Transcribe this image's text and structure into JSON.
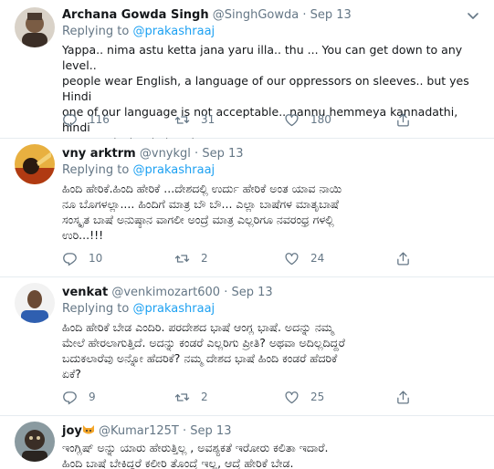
{
  "tweets": [
    {
      "name": "Archana Gowda Singh",
      "handle": "@SinghGowda",
      "date": "Sep 13",
      "replying_prefix": "Replying to",
      "replying_to": "@prakashraaj",
      "text_lines": [
        "Yappa.. nima astu ketta jana yaru illa.. thu ...  You can get down to any level..",
        "people wear English, a language of our oppressors on sleeves.. but yes Hindi",
        "one of our language is not acceptable.. nannu hemmeya kannadathi, hindi",
        "namma desha da basshe..."
      ],
      "replies": "116",
      "retweets": "31",
      "likes": "180",
      "avatar_color": "#6b5a4e"
    },
    {
      "name": "vny arktrm",
      "handle": "@vnykgl",
      "date": "Sep 13",
      "replying_prefix": "Replying to",
      "replying_to": "@prakashraaj",
      "text_lines": [
        "ಹಿಂದಿ ಹೇರಿಕೆ.ಹಿಂದಿ ಹೇರಿಕೆ ...ದೇಶದಲ್ಲಿ ಉರ್ದು ಹೇರಿಕೆ ಅಂತ ಯಾವ ನಾಯಿ",
        "ನೂ ಬೊಗಳಲ್ಲಾ.... ಹಿಂದಿಗೆ ಮಾತ್ರ ಬೌ ಬೌ... ಎಲ್ಲಾ ಬಾಷೆಗಳ ಮಾತೃಬಾಷೆ",
        "ಸಂಸ್ಕೃತ ಬಾಷೆ ಅನುಷ್ಠಾನ ವಾಗಲೀ ಅಂದ್ರೆ ಮಾತ್ರ ಎಲ್ಲರಿಗೂ ನವರಂಧ್ರ ಗಳಲ್ಲಿ",
        "ಉರಿ...!!!"
      ],
      "replies": "10",
      "retweets": "2",
      "likes": "24",
      "avatar_color": "#c8531c"
    },
    {
      "name": "venkat",
      "handle": "@venkimozart600",
      "date": "Sep 13",
      "replying_prefix": "Replying to",
      "replying_to": "@prakashraaj",
      "text_lines": [
        "ಹಿಂದಿ ಹೇರಿಕೆ ಬೇಡ ಎಂದಿರಿ. ಪರದೇಶದ ಭಾಷೆ ಆಂಗ್ಲ ಭಾಷೆ. ಅದನ್ನು ನಮ್ಮ",
        "ಮೇಲೆ ಹೇರಲಾಗುತ್ತಿದೆ. ಅದನ್ನು ಕಂಡರೆ ಎಲ್ಲರಿಗು ಪ್ರೀತಿ? ಅಥವಾ ಅದಿಲ್ಲದಿದ್ದರೆ",
        "ಬದುಕಲಾರೆವು ಅನ್ನೋ ಹೆದರಿಕೆ?  ನಮ್ಮ ದೇಶದ ಭಾಷೆ  ಹಿಂದಿ ಕಂಡರೆ ಹೆದರಿಕೆ",
        "ಏಕೆ?"
      ],
      "replies": "9",
      "retweets": "2",
      "likes": "25",
      "avatar_color": "#3a5a8c"
    },
    {
      "name": "joy",
      "handle": "@Kumar125T",
      "date": "Sep 13",
      "text_lines": [
        "ಇಂಗ್ಲಿಷ್ ಅನ್ನು ಯಾರು ಹೇರುತ್ತಿಲ್ಲ , ಅವಶ್ಯಕತೆ ಇರೋರು ಕಲಿತಾ ಇದಾರೆ.",
        "ಹಿಂದಿ ಬಾಷೆ ಬೇಕಿದ್ದರೆ ಕಲೀರಿ ತೊಂದ್ರೆ ಇಲ್ಲ, ಆದ್ರೆ ಹೇರಿಕೆ ಬೇಡ."
      ],
      "avatar_color": "#4a4038"
    }
  ],
  "colors": {
    "accent": "#1da1f2",
    "secondary_text": "#657786",
    "divider": "#e6ecf0"
  },
  "icons": [
    "reply-icon",
    "retweet-icon",
    "like-icon",
    "share-icon",
    "caret-down-icon",
    "cat-face-emoji-icon"
  ]
}
